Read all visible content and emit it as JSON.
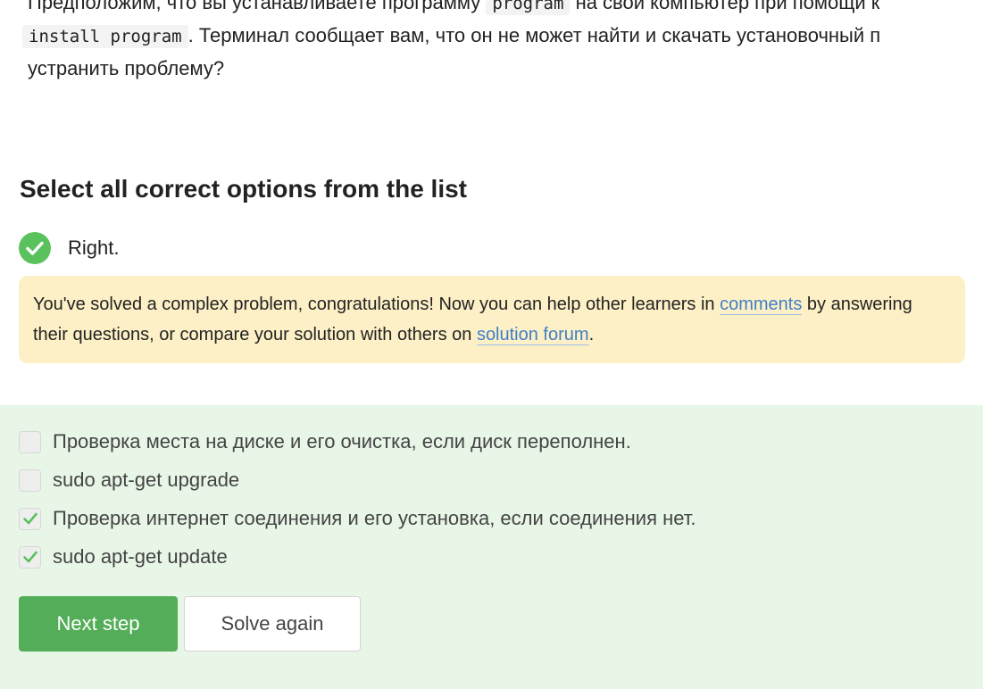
{
  "question": {
    "line1_pre": "Предположим, что вы устанавливаете программу",
    "line1_code": "program",
    "line1_post": "на свой компьютер при помощи к",
    "line2_code": "install program",
    "line2_post": ". Терминал сообщает вам, что он не может найти и скачать установочный п",
    "line3": "устранить проблему?"
  },
  "quiz": {
    "heading": "Select all correct options from the list",
    "result_label": "Right.",
    "result_icon": "check-circle-icon",
    "notice": {
      "text_before": "You've solved a complex problem, congratulations! Now you can help other learners in",
      "comments_link": "comments",
      "text_middle": "by answering their questions, or compare your solution with others on",
      "forum_link": "solution forum",
      "text_after": "."
    },
    "options": [
      {
        "label": "Проверка места на диске и его очистка, если диск переполнен.",
        "checked": false
      },
      {
        "label": "sudo apt-get upgrade",
        "checked": false
      },
      {
        "label": "Проверка интернет соединения и его установка, если соединения нет.",
        "checked": true
      },
      {
        "label": "sudo apt-get update",
        "checked": true
      }
    ],
    "buttons": {
      "next": "Next step",
      "solve_again": "Solve again"
    }
  },
  "colors": {
    "success": "#59c25d",
    "primary_button": "#54ad58",
    "notice_bg": "#fdf0c6",
    "options_bg": "#e8f6e7",
    "link": "#3f7fc6"
  }
}
